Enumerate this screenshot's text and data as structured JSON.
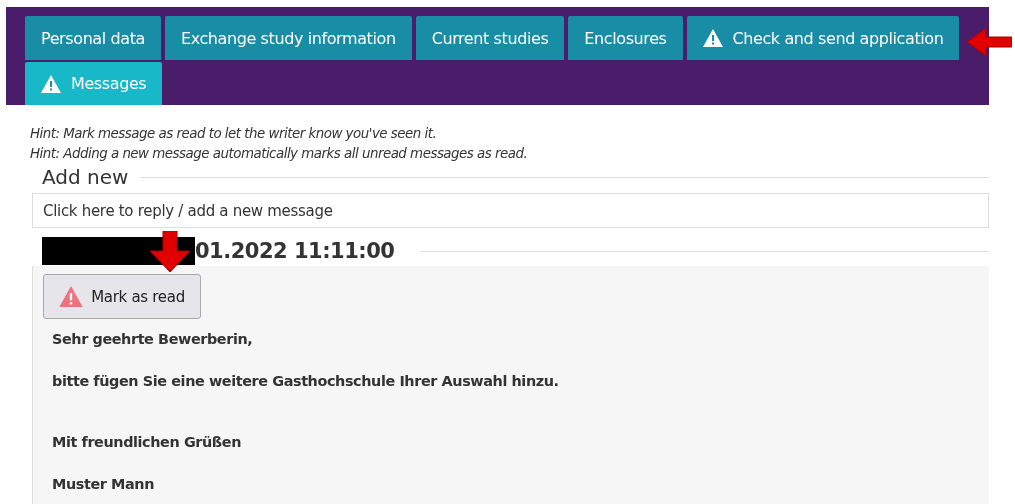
{
  "tabs": [
    {
      "label": "Personal data",
      "selected": false,
      "warning": false
    },
    {
      "label": "Exchange study information",
      "selected": false,
      "warning": false
    },
    {
      "label": "Current studies",
      "selected": false,
      "warning": false
    },
    {
      "label": "Enclosures",
      "selected": false,
      "warning": false
    },
    {
      "label": "Check and send application",
      "selected": false,
      "warning": true
    },
    {
      "label": "Messages",
      "selected": true,
      "warning": true
    }
  ],
  "hints": [
    "Hint: Mark message as read to let the writer know you've seen it.",
    "Hint: Adding a new message automatically marks all unread messages as read."
  ],
  "add_new": {
    "title": "Add new",
    "prompt": "Click here to reply / add a new message"
  },
  "message": {
    "date": "01.2022 11:11:00",
    "button": "Mark as read",
    "unread": true,
    "paragraphs": [
      "Sehr geehrte Bewerberin,",
      "bitte fügen Sie eine weitere Gasthochschule Ihrer Auswahl hinzu.",
      "Mit freundlichen Grüßen",
      "Muster Mann"
    ]
  }
}
